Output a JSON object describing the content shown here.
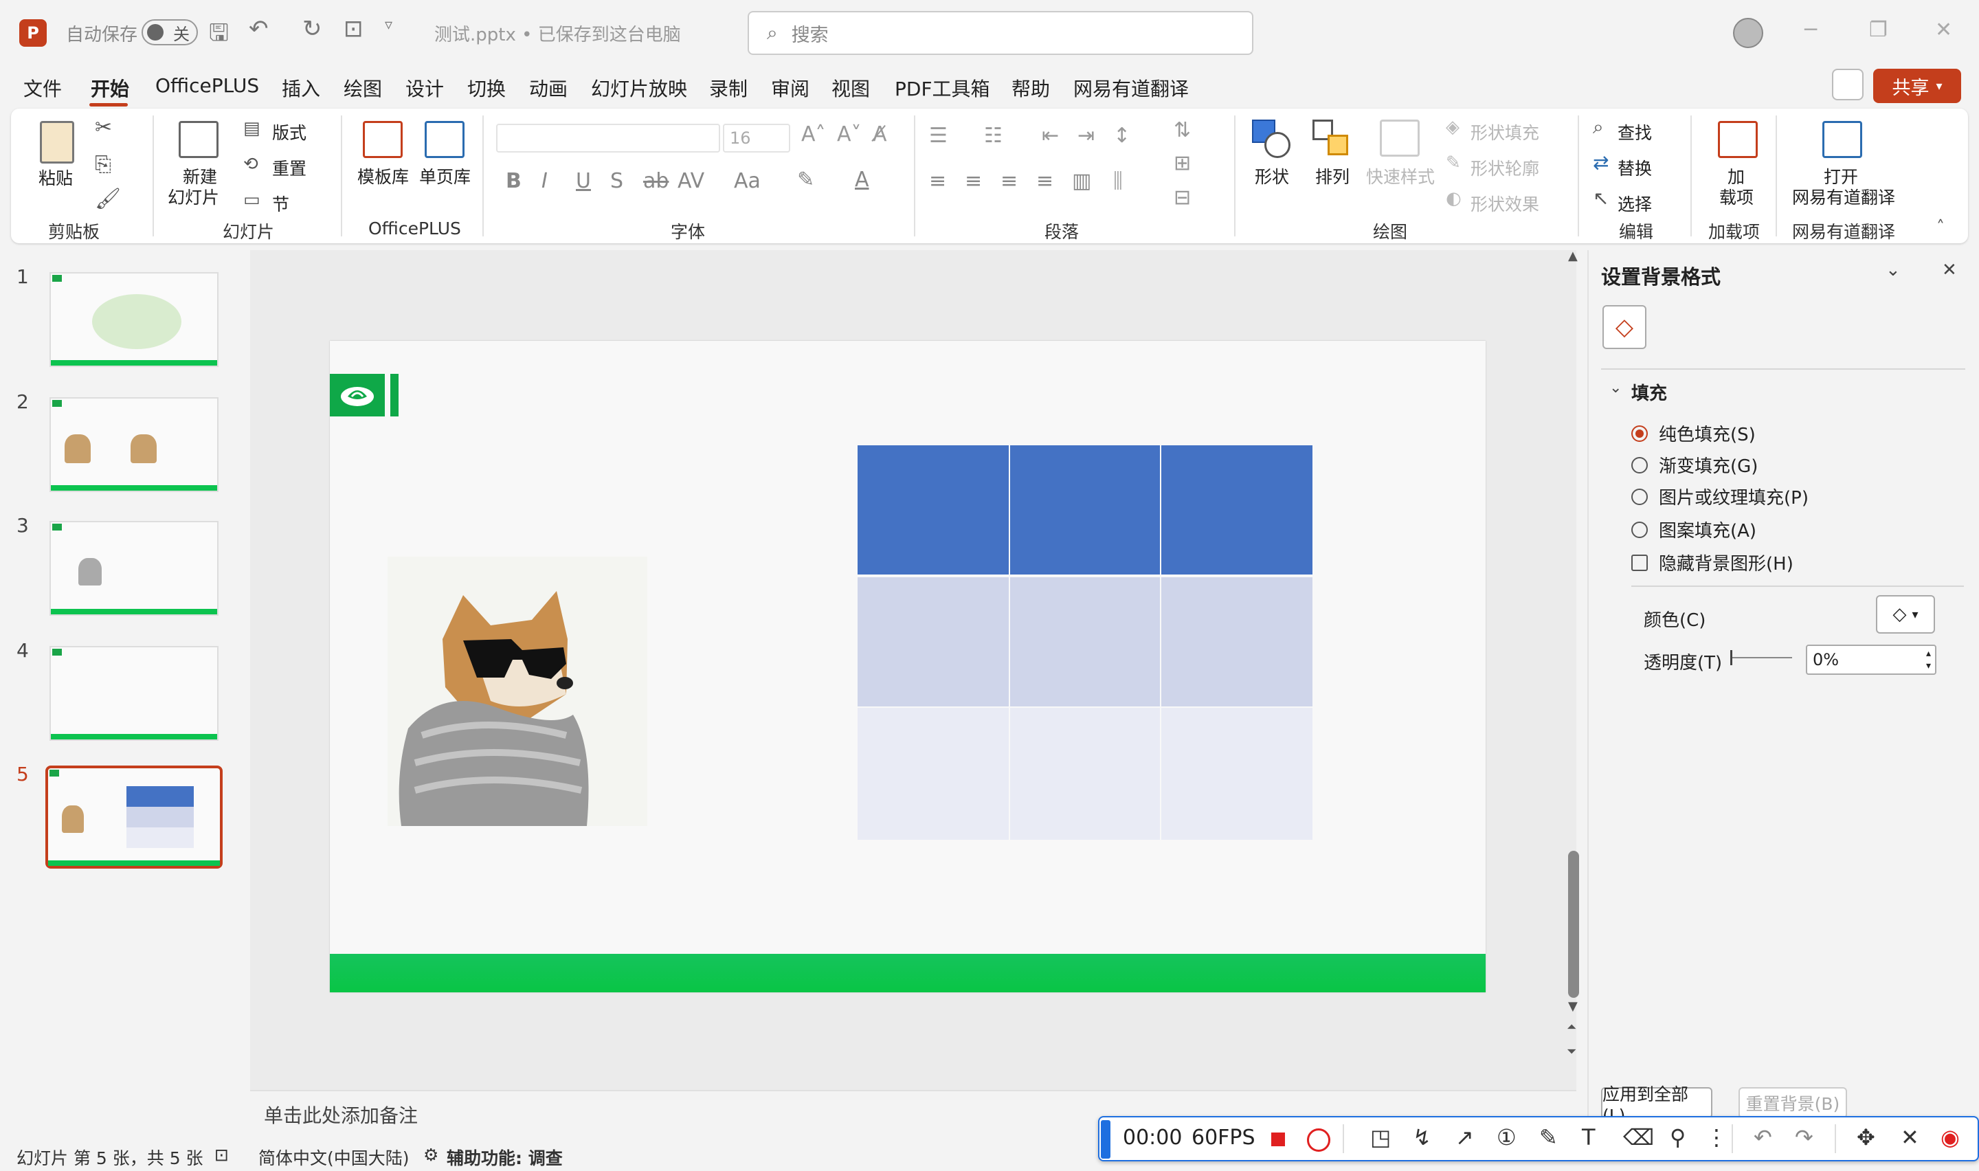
{
  "app": {
    "logo": "P",
    "autosave_label": "自动保存",
    "autosave_state": "关",
    "doc_title": "测试.pptx • 已保存到这台电脑",
    "search_placeholder": "搜索"
  },
  "menu": {
    "items": [
      "文件",
      "开始",
      "OfficePLUS",
      "插入",
      "绘图",
      "设计",
      "切换",
      "动画",
      "幻灯片放映",
      "录制",
      "审阅",
      "视图",
      "PDF工具箱",
      "帮助",
      "网易有道翻译"
    ],
    "active": "开始",
    "share_label": "共享"
  },
  "ribbon": {
    "clipboard": {
      "paste": "粘贴",
      "group": "剪贴板"
    },
    "slides": {
      "new_slide_1": "新建",
      "new_slide_2": "幻灯片",
      "layout": "版式",
      "reset": "重置",
      "section": "节",
      "group": "幻灯片"
    },
    "officeplus": {
      "template": "模板库",
      "single_page": "单页库",
      "group": "OfficePLUS"
    },
    "font": {
      "size": "16",
      "group": "字体"
    },
    "paragraph": {
      "group": "段落"
    },
    "drawing": {
      "shape": "形状",
      "arrange": "排列",
      "quick_style": "快速样式",
      "shape_fill": "形状填充",
      "shape_outline": "形状轮廓",
      "shape_effect": "形状效果",
      "group": "绘图"
    },
    "editing": {
      "find": "查找",
      "replace": "替换",
      "select": "选择",
      "group": "编辑"
    },
    "addins": {
      "label_1": "加",
      "label_2": "载项",
      "group": "加载项"
    },
    "youdao": {
      "label_1": "打开",
      "label_2": "网易有道翻译",
      "group": "网易有道翻译"
    }
  },
  "thumbnails": [
    {
      "num": "1",
      "active": false
    },
    {
      "num": "2",
      "active": false
    },
    {
      "num": "3",
      "active": false
    },
    {
      "num": "4",
      "active": false
    },
    {
      "num": "5",
      "active": true
    }
  ],
  "slide": {
    "table": {
      "header_color": "#4472c4",
      "row_colors": [
        "#cfd5ea",
        "#e9ebf5"
      ],
      "rows": 3,
      "cols": 3
    },
    "bottom_bar_color": "#0cc34f"
  },
  "notes": {
    "placeholder": "单击此处添加备注"
  },
  "format_pane": {
    "title": "设置背景格式",
    "section": "填充",
    "options": [
      {
        "label": "纯色填充(S)",
        "type": "radio",
        "selected": true
      },
      {
        "label": "渐变填充(G)",
        "type": "radio",
        "selected": false
      },
      {
        "label": "图片或纹理填充(P)",
        "type": "radio",
        "selected": false
      },
      {
        "label": "图案填充(A)",
        "type": "radio",
        "selected": false
      },
      {
        "label": "隐藏背景图形(H)",
        "type": "checkbox",
        "selected": false
      }
    ],
    "color_label": "颜色(C)",
    "transparency_label": "透明度(T)",
    "transparency_value": "0%",
    "apply_all": "应用到全部(L)",
    "reset_bg": "重置背景(B)"
  },
  "statusbar": {
    "slide_info": "幻灯片 第 5 张，共 5 张",
    "language": "简体中文(中国大陆)",
    "accessibility": "辅助功能: 调查"
  },
  "recorder": {
    "time": "00:00",
    "fps": "60FPS"
  }
}
